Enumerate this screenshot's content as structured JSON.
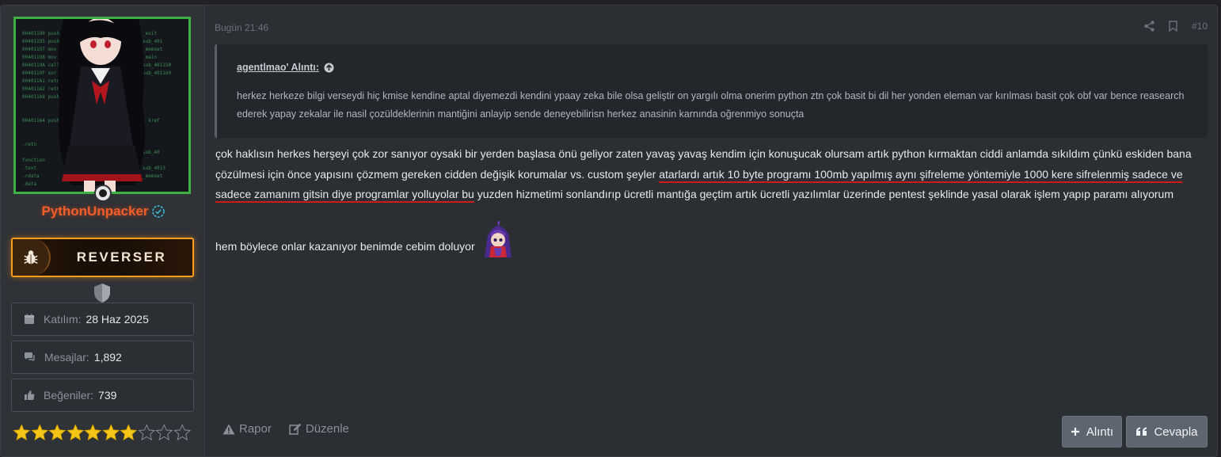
{
  "user": {
    "username": "PythonUnpacker",
    "banner": "REVERSER",
    "stats": [
      {
        "icon": "calendar-icon",
        "label": "Katılım:",
        "value": "28 Haz 2025"
      },
      {
        "icon": "messages-icon",
        "label": "Mesajlar:",
        "value": "1,892"
      },
      {
        "icon": "thumbs-up-icon",
        "label": "Beğeniler:",
        "value": "739"
      }
    ],
    "rating": {
      "filled": 7,
      "total": 10
    },
    "colors": {
      "username": "#f15e2a",
      "banner_border": "#ff9d1c",
      "avatar_border": "#3fb144"
    }
  },
  "post": {
    "timestamp": "Bugün 21:46",
    "number": "#10",
    "quote": {
      "author": "agentlmao' Alıntı:",
      "text": "herkez herkeze bilgi verseydi hiç kmise kendine aptal diyemezdi kendini ypaay zeka bile olsa geliştir on yargılı olma onerim python ztn çok basit bi dil her yonden eleman var kırılması basit çok obf var bence reasearch ederek yapay zekalar ile nasil çozüldeklerinin mantiğini anlayip sende deneyebilirisn herkez anasinin karnında oğrenmiyo sonuçta"
    },
    "body": {
      "part1": "çok haklısın herkes herşeyi çok zor sanıyor oysaki bir yerden başlasa önü geliyor zaten yavaş yavaş kendim için konuşucak olursam artık python kırmaktan ciddi anlamda sıkıldım çünkü eskiden bana çözülmesi için önce yapısını çözmem gereken cidden değişik korumalar vs. custom şeyler ",
      "underlined": "atarlardı artık 10 byte programı 100mb yapılmış aynı şifreleme yöntemiyle 1000 kere sifrelenmiş sadece ve sadece zamanım gitsin diye programlar yolluyolar bu",
      "part2": " yuzden hizmetimi sonlandırıp ücretli mantığa geçtim artık ücretli yazılımlar üzerinde pentest şeklinde yasal olarak işlem yapıp paramı alıyorum",
      "line2": "hem böylece onlar kazanıyor benimde cebim doluyor"
    },
    "actions": {
      "report": "Rapor",
      "edit": "Düzenle"
    },
    "buttons": {
      "quote": "Alıntı",
      "reply": "Cevapla"
    }
  }
}
